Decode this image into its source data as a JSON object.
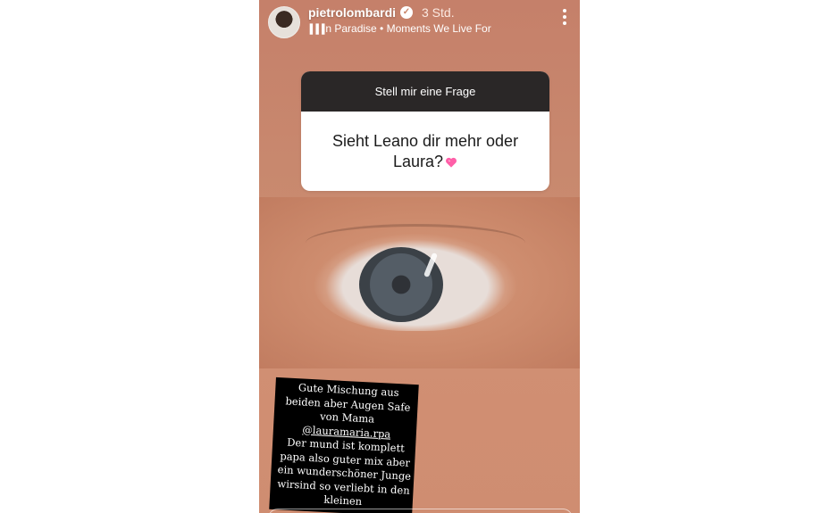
{
  "story": {
    "username": "pietrolombardi",
    "verified_icon": "check-icon",
    "time": "3 Std.",
    "music": {
      "song": "In Paradise",
      "separator": " • ",
      "artist": "Moments We Live For"
    },
    "more_icon": "more-vertical-icon"
  },
  "question_sticker": {
    "header": "Stell mir eine Frage",
    "question": "Sieht Leano dir mehr oder Laura?",
    "emoji": "pink-heart"
  },
  "caption": {
    "line1": "Gute Mischung aus",
    "line2": "beiden aber Augen Safe",
    "line3": "von Mama",
    "mention": "@lauramaria.rpa",
    "line5": "Der mund ist komplett",
    "line6": "papa also guter mix aber",
    "line7": "ein wunderschöner Junge",
    "line8": "wirsind so verliebt in den",
    "line9": "kleinen"
  },
  "colors": {
    "story_bg": "#c98468",
    "sticker_header": "#2a2727",
    "heart": "#ff5fa8"
  }
}
